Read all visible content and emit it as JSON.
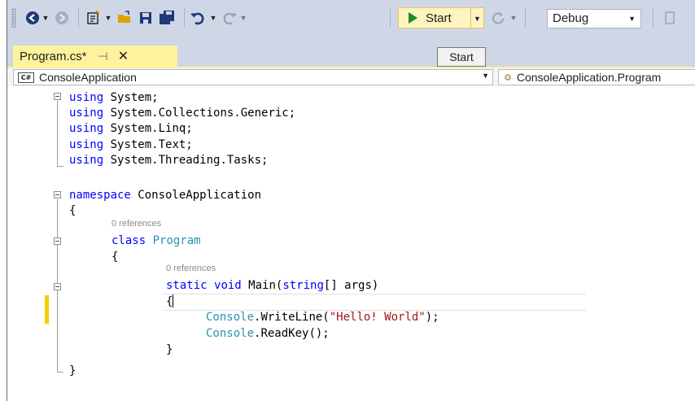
{
  "toolbar": {
    "start_label": "Start",
    "config_value": "Debug"
  },
  "tab": {
    "title": "Program.cs*",
    "pin_glyph": "⊣",
    "close_glyph": "✕"
  },
  "tooltip": {
    "text": "Start"
  },
  "navbar": {
    "left_badge": "C#",
    "left_value": "ConsoleApplication",
    "right_value": "ConsoleApplication.Program"
  },
  "code": {
    "l1_kw": "using",
    "l1_rest": " System;",
    "l2_kw": "using",
    "l2_rest": " System.Collections.Generic;",
    "l3_kw": "using",
    "l3_rest": " System.Linq;",
    "l4_kw": "using",
    "l4_rest": " System.Text;",
    "l5_kw": "using",
    "l5_rest": " System.Threading.Tasks;",
    "l7_kw": "namespace",
    "l7_rest": " ConsoleApplication",
    "brace_open": "{",
    "brace_close": "}",
    "lens_class": "0 references",
    "class_kw": "class",
    "class_name": "Program",
    "lens_main": "0 references",
    "main_kw1": "static",
    "main_kw2": "void",
    "main_name": " Main(",
    "main_kw3": "string",
    "main_rest": "[] args)",
    "wl_type": "Console",
    "wl_method": ".WriteLine(",
    "wl_str": "\"Hello! World\"",
    "wl_end": ");",
    "rk_type": "Console",
    "rk_rest": ".ReadKey();"
  }
}
